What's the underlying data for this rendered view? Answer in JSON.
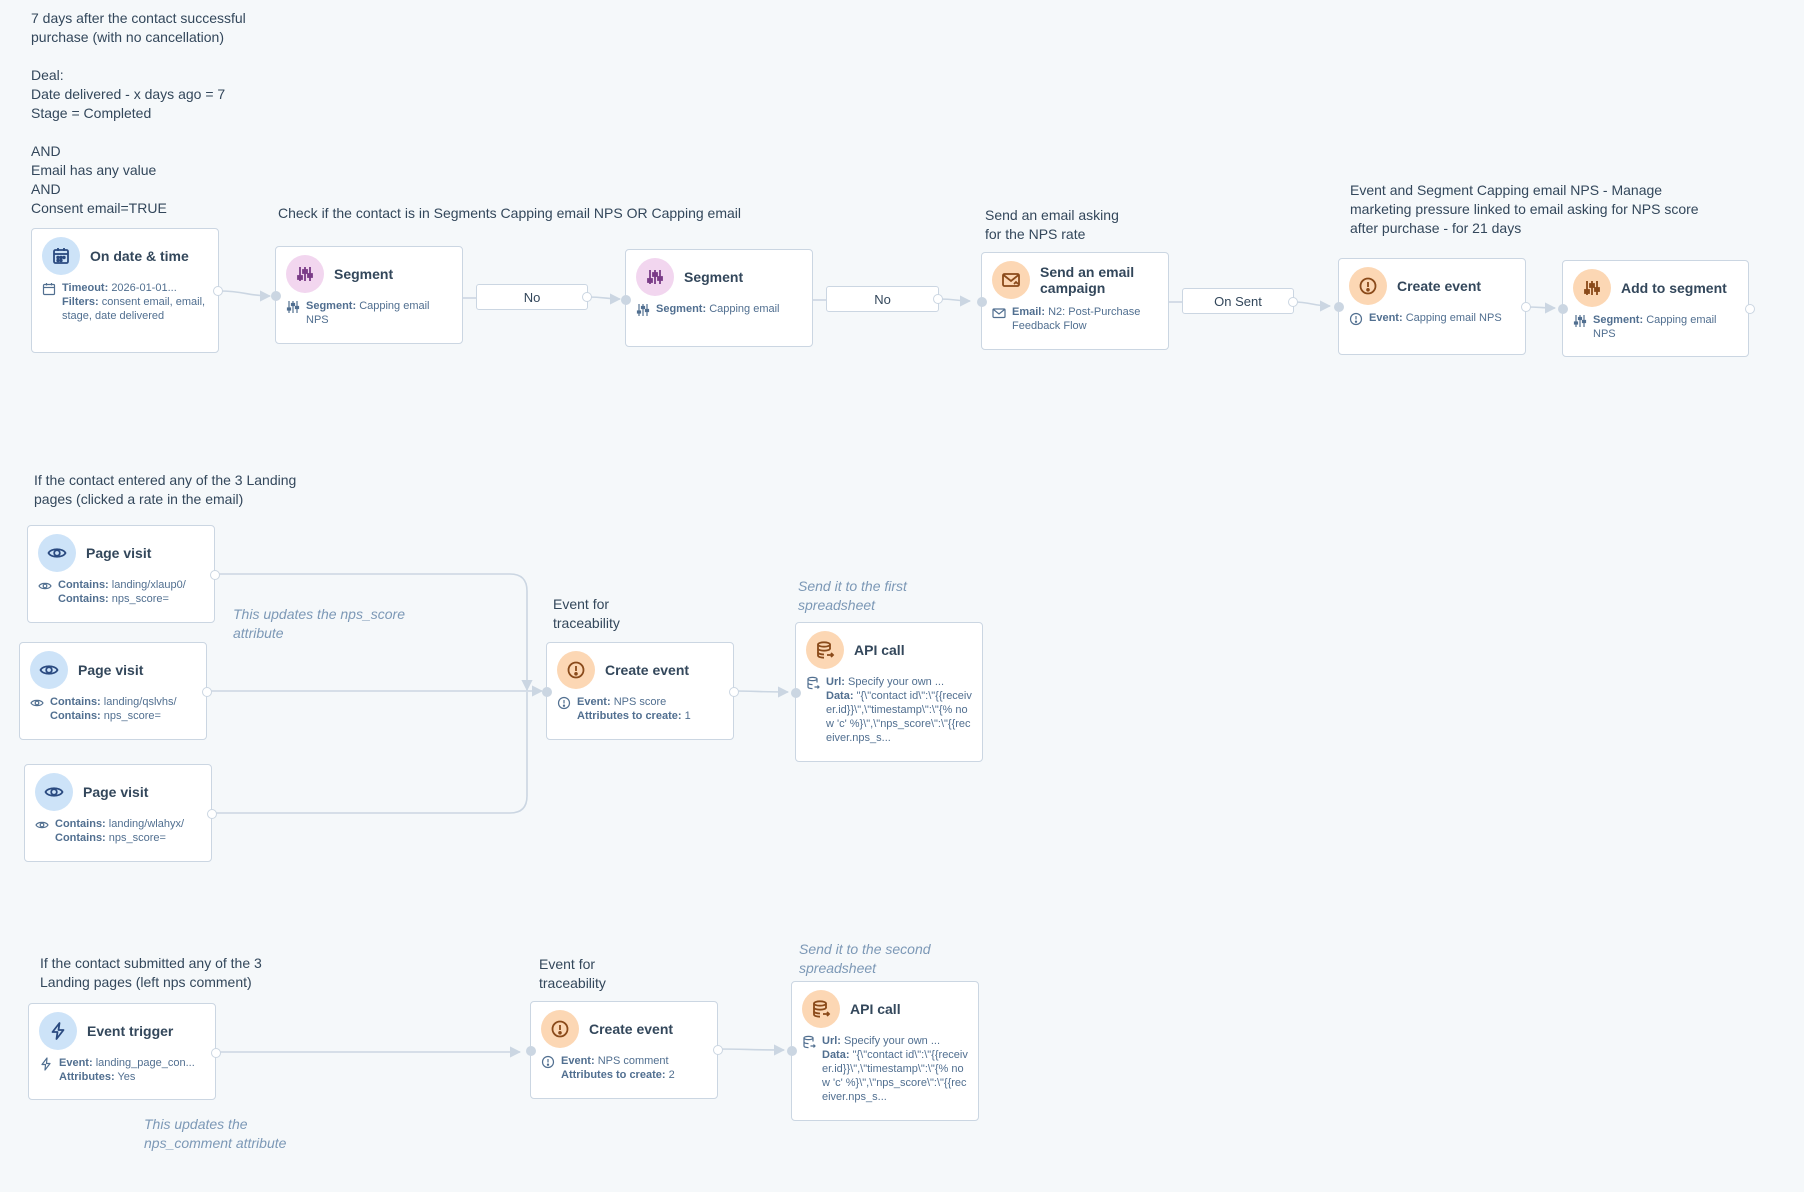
{
  "colors": {
    "wire": "#cbd6e2",
    "node_border": "#cbd6e2",
    "text": "#33475b",
    "muted": "#516f90",
    "italic": "#7c98b6"
  },
  "notes": {
    "trigger_criteria": "7 days after the contact successful\npurchase (with no cancellation)\n\nDeal:\nDate delivered - x days ago = 7\nStage = Completed\n\nAND\nEmail has any value\nAND\nConsent email=TRUE",
    "check_segments": "Check if the contact is in Segments Capping email NPS OR Capping email",
    "send_email": "Send an email asking\nfor the NPS rate",
    "event_segment_capping": "Event and Segment Capping email NPS - Manage\nmarketing pressure linked to email asking for NPS score\nafter purchase - for 21 days",
    "landing_pages": "If the contact entered any of the 3 Landing\npages (clicked a rate in the email)",
    "updates_score": "This updates the nps_score\nattribute",
    "event_traceability_1": "Event for\ntraceability",
    "first_spreadsheet": "Send it to the first\nspreadsheet",
    "submitted_pages": "If the contact submitted any of the 3\nLanding pages (left nps comment)",
    "event_traceability_2": "Event for\ntraceability",
    "second_spreadsheet": "Send it to the second\nspreadsheet",
    "updates_comment": "This updates the\nnps_comment attribute"
  },
  "nodes": {
    "date_trigger": {
      "title": "On date & time",
      "icon": "calendar-icon",
      "timeout_label": "Timeout:",
      "timeout_value": "2026-01-01...",
      "filters_label": "Filters:",
      "filters_value": "consent email, email, stage, date delivered"
    },
    "segment_1": {
      "title": "Segment",
      "icon": "sliders-icon",
      "label": "Segment:",
      "value": "Capping email NPS"
    },
    "segment_2": {
      "title": "Segment",
      "icon": "sliders-icon",
      "label": "Segment:",
      "value": "Capping email"
    },
    "email_campaign": {
      "title": "Send an email campaign",
      "icon": "mail-icon",
      "label": "Email:",
      "value": "N2: Post-Purchase Feedback Flow"
    },
    "create_event_top": {
      "title": "Create event",
      "icon": "alert-icon",
      "label": "Event:",
      "value": "Capping email NPS"
    },
    "add_segment": {
      "title": "Add to segment",
      "icon": "sliders-icon",
      "label": "Segment:",
      "value": "Capping email NPS"
    },
    "page_visit_1": {
      "title": "Page visit",
      "icon": "eye-icon",
      "label1": "Contains:",
      "value1": "landing/xlaup0/",
      "label2": "Contains:",
      "value2": "nps_score="
    },
    "page_visit_2": {
      "title": "Page visit",
      "icon": "eye-icon",
      "label1": "Contains:",
      "value1": "landing/qslvhs/",
      "label2": "Contains:",
      "value2": "nps_score="
    },
    "page_visit_3": {
      "title": "Page visit",
      "icon": "eye-icon",
      "label1": "Contains:",
      "value1": "landing/wlahyx/",
      "label2": "Contains:",
      "value2": "nps_score="
    },
    "create_event_score": {
      "title": "Create event",
      "icon": "alert-icon",
      "label1": "Event:",
      "value1": "NPS score",
      "label2": "Attributes to create:",
      "value2": "1"
    },
    "api_call_1": {
      "title": "API call",
      "icon": "database-icon",
      "url_label": "Url:",
      "url_value": "Specify your own ...",
      "data_label": "Data:",
      "data_value": "\"{\\\"contact id\\\":\\\"{{receiver.id}}\\\",\\\"timestamp\\\":\\\"{% now 'c' %}\\\",\\\"nps_score\\\":\\\"{{receiver.nps_s..."
    },
    "event_trigger": {
      "title": "Event trigger",
      "icon": "lightning-icon",
      "label1": "Event:",
      "value1": "landing_page_con...",
      "label2": "Attributes:",
      "value2": "Yes"
    },
    "create_event_comment": {
      "title": "Create event",
      "icon": "alert-icon",
      "label1": "Event:",
      "value1": "NPS comment",
      "label2": "Attributes to create:",
      "value2": "2"
    },
    "api_call_2": {
      "title": "API call",
      "icon": "database-icon",
      "url_label": "Url:",
      "url_value": "Specify your own ...",
      "data_label": "Data:",
      "data_value": "\"{\\\"contact id\\\":\\\"{{receiver.id}}\\\",\\\"timestamp\\\":\\\"{% now 'c' %}\\\",\\\"nps_score\\\":\\\"{{receiver.nps_s..."
    }
  },
  "branches": {
    "no_1": "No",
    "no_2": "No",
    "on_sent": "On Sent"
  }
}
